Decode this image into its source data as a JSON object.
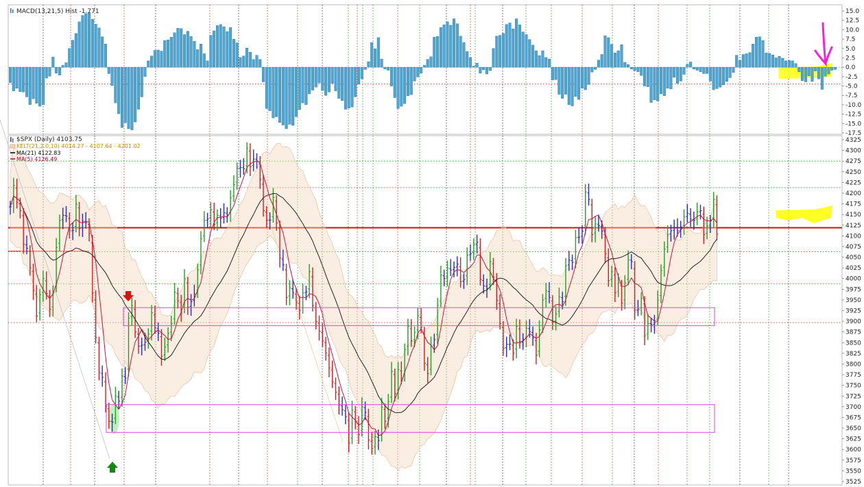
{
  "macd_panel": {
    "title": "MACD(13,21,5) Hist -1.771",
    "yticks": [
      "15.0",
      "12.5",
      "10.0",
      "7.5",
      "5.0",
      "2.5",
      "0.0",
      "-2.5",
      "-5.0",
      "-7.5",
      "-10.0",
      "-12.5",
      "-15.0",
      "-17.5"
    ],
    "ylim": [
      -17.5,
      15.0
    ]
  },
  "price_panel": {
    "title": "$SPX (Daily) 4103.75",
    "legend": [
      {
        "text": "KELT(21,2.0,10) 4014.27 - 4107.64 - 4201.02",
        "color": "#d08a00"
      },
      {
        "text": "MA(21) 4122.83",
        "color": "#000000"
      },
      {
        "text": "MA(5) 4126.49",
        "color": "#c8003c"
      }
    ],
    "yticks": [
      "4325",
      "4300",
      "4275",
      "4250",
      "4225",
      "4200",
      "4175",
      "4150",
      "4125",
      "4100",
      "4075",
      "4050",
      "4025",
      "4000",
      "3975",
      "3950",
      "3925",
      "3900",
      "3875",
      "3850",
      "3825",
      "3800",
      "3775",
      "3750",
      "3725",
      "3700",
      "3675",
      "3650",
      "3625",
      "3600",
      "3575",
      "3550",
      "3525"
    ],
    "ylim": [
      3525,
      4325
    ]
  },
  "chart_data": [
    {
      "type": "bar",
      "title": "MACD(13,21,5) Hist -1.771",
      "xlabel": "",
      "ylabel": "",
      "ylim": [
        -17.5,
        15.0
      ],
      "series": [
        {
          "values": [
            -4.1,
            -6.3,
            -5.6,
            -6.5,
            -6.6,
            -7.9,
            -10,
            -8.4,
            -9.6,
            -10.4,
            -10,
            -2.9,
            -2.4,
            2.7,
            -1.6,
            -2.1,
            0.5,
            1.2,
            5,
            7.2,
            9,
            12.1,
            13.8,
            14.3,
            14.6,
            12.8,
            11.5,
            10.5,
            8.1,
            6.2,
            -1.7,
            -4.9,
            -9.5,
            -12.4,
            -16.1,
            -14.8,
            -16.4,
            -16.7,
            -14.6,
            -11.2,
            -7.9,
            -2.5,
            1.7,
            3,
            4.5,
            4.6,
            4.3,
            7.1,
            7.3,
            8,
            9.2,
            10.4,
            10.3,
            8.7,
            9.6,
            8.2,
            6.9,
            4.7,
            6.2,
            3.6,
            1.7,
            8.5,
            9.7,
            11.1,
            11.4,
            10.8,
            9.5,
            10.6,
            7.5,
            6.5,
            2.6,
            3,
            5.1,
            4,
            2.1,
            3.2,
            2.1,
            -3.9,
            -11,
            -11.6,
            -13.5,
            -13.2,
            -14.7,
            -15.4,
            -16.4,
            -15.2,
            -15.5,
            -13.2,
            -11.3,
            -9.5,
            -10,
            -7.1,
            -6.1,
            -5.3,
            -4.2,
            -6.2,
            -7.5,
            -6.6,
            -4.3,
            -6.3,
            -8.3,
            -8.9,
            -11.2,
            -10.9,
            -10.6,
            -7.9,
            -4.5,
            -3.1,
            -0.6,
            1.5,
            6.6,
            4.9,
            7.9,
            2.2,
            -0.5,
            -0.8,
            -5,
            -8.1,
            -11,
            -10.4,
            -9.7,
            -7.6,
            -7.3,
            -3.7,
            -2.6,
            -1.6,
            0.5,
            2.1,
            2.8,
            8,
            8.2,
            10.6,
            11.3,
            12.1,
            11.2,
            12.9,
            11.6,
            8.3,
            6.6,
            4.2,
            2.6,
            0.3,
            1.1,
            -1.6,
            -0.7,
            -1.8,
            -0.9,
            5,
            8.3,
            8.5,
            9,
            11.4,
            11.8,
            10.2,
            12.9,
            11.3,
            9.4,
            8.7,
            7.4,
            5.9,
            4.4,
            3.1,
            4.4,
            2.6,
            2.2,
            -3.4,
            -3.3,
            -7.2,
            -8.3,
            -7.2,
            -10,
            -10.3,
            -7.8,
            -8.6,
            -5.6,
            -6,
            -4.6,
            -1.3,
            -0.6,
            1.9,
            3.4,
            8.4,
            7.9,
            6.1,
            3.8,
            4.4,
            6,
            1.3,
            0.7,
            -0.5,
            -0.9,
            -1.2,
            -2.2,
            -5,
            -5.2,
            -9.4,
            -8.7,
            -9,
            -7.1,
            -7.6,
            -5.6,
            -5.8,
            -2.7,
            -4.3,
            -3.7,
            -1.9,
            0.8,
            1.4,
            -0.5,
            -0.8,
            -1.2,
            -1.7,
            -1.7,
            -3.7,
            -6,
            -5.7,
            -5.3,
            -4.7,
            -3.8,
            -2.8,
            -1.4,
            3.2,
            1.8,
            3.4,
            3.6,
            3.9,
            6.2,
            8,
            8.1,
            7.1,
            3.8,
            3.7,
            3.3,
            2.5,
            2.9,
            2.4,
            1.7,
            1.8,
            1.7,
            1,
            -1.2,
            -3.6,
            -3.9,
            -2.3,
            -3.8,
            -1,
            -3.1,
            -5.9,
            -2.4,
            -1.8,
            -0.8,
            -0.6
          ]
        }
      ]
    },
    {
      "type": "candlestick",
      "title": "$SPX (Daily) 4103.75",
      "xlabel": "",
      "ylabel": "",
      "ylim": [
        3525,
        4325
      ],
      "close": [
        4168,
        4218,
        4178,
        4159,
        4080,
        4071,
        4025,
        3972,
        3912,
        3962,
        4000,
        3965,
        3928,
        3966,
        4073,
        4136,
        4148,
        4146,
        4112,
        4113,
        4174,
        4117,
        4134,
        4131,
        4105,
        3966,
        3862,
        3780,
        3769,
        3701,
        3666,
        3664,
        3725,
        3713,
        3772,
        3767,
        3907,
        3937,
        3875,
        3842,
        3844,
        3851,
        3870,
        3920,
        3885,
        3872,
        3818,
        3840,
        3872,
        3895,
        3968,
        3948,
        3921,
        4000,
        3933,
        3946,
        3964,
        4021,
        4093,
        4136,
        4140,
        4161,
        4127,
        4148,
        4141,
        4154,
        4149,
        4189,
        4220,
        4258,
        4260,
        4257,
        4305,
        4262,
        4280,
        4275,
        4232,
        4159,
        4137,
        4137,
        4190,
        4130,
        4048,
        4032,
        3956,
        3978,
        3967,
        3945,
        3926,
        3967,
        3969,
        4016,
        3937,
        3899,
        3877,
        3854,
        3826,
        3791,
        3758,
        3734,
        3704,
        3693,
        3677,
        3615,
        3692,
        3665,
        3635,
        3700,
        3687,
        3622,
        3602,
        3630,
        3621,
        3699,
        3666,
        3712,
        3783,
        3731,
        3787,
        3767,
        3834,
        3888,
        3854,
        3874,
        3913,
        3886,
        3802,
        3778,
        3842,
        3857,
        3937,
        4008,
        4000,
        4024,
        4020,
        4026,
        4034,
        3993,
        3998,
        4055,
        4058,
        4080,
        4085,
        3998,
        3983,
        3977,
        4040,
        4003,
        3949,
        3895,
        3837,
        3846,
        3847,
        3826,
        3888,
        3850,
        3858,
        3884,
        3876,
        3861,
        3821,
        3880,
        3950,
        3972,
        3956,
        3898,
        3917,
        3957,
        3946,
        4030,
        4043,
        4038,
        4096,
        4097,
        4111,
        4203,
        4185,
        4103,
        4128,
        4124,
        4111,
        4058,
        3995,
        4016,
        3967,
        3990,
        3943,
        3990,
        4044,
        4040,
        3926,
        3928,
        3954,
        3866,
        3895,
        3892,
        3897,
        3950,
        4019,
        4069,
        4103,
        4112,
        4120,
        4112,
        4121,
        4144,
        4153,
        4139,
        4136,
        4156,
        4159,
        4103,
        4123,
        4135,
        4185,
        4104
      ]
    }
  ]
}
